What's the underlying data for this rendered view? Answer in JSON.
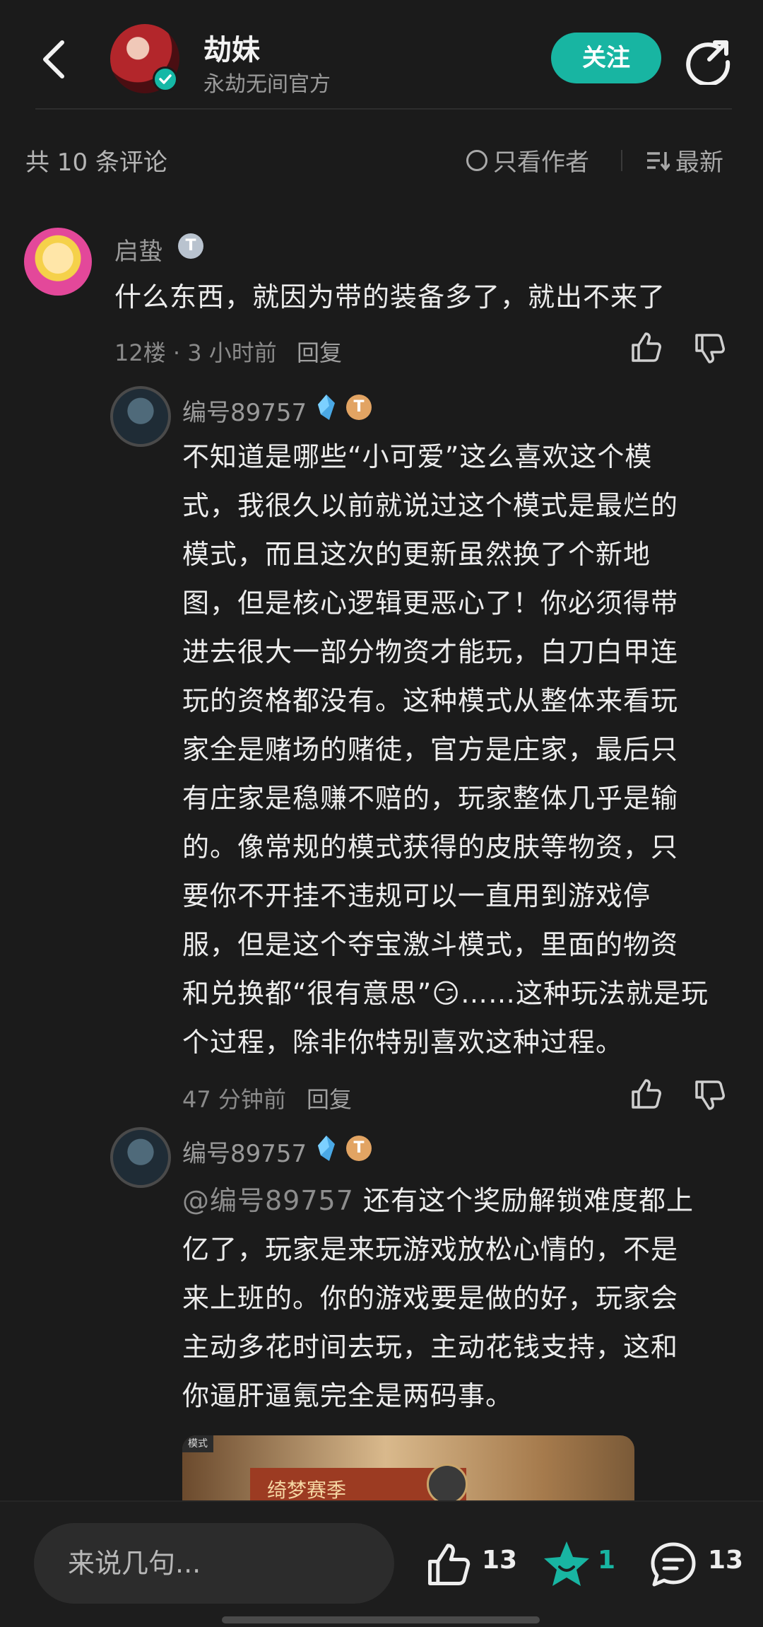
{
  "header": {
    "name": "劫妹",
    "subtitle": "永劫无间官方",
    "follow_label": "关注"
  },
  "filter": {
    "count_label": "共 10 条评论",
    "author_only_label": "只看作者",
    "sort_label": "最新"
  },
  "comments": [
    {
      "user": "启蛰",
      "badge": "T",
      "text": "什么东西，就因为带的装备多了，就出不来了",
      "meta": "12楼 · 3 小时前",
      "reply_label": "回复"
    },
    {
      "user": "编号89757",
      "badge": "T",
      "lines": [
        "不知道是哪些“小可爱”这么喜欢这个模",
        "式，我很久以前就说过这个模式是最烂的",
        "模式，而且这次的更新虽然换了个新地",
        "图，但是核心逻辑更恶心了！你必须得带",
        "进去很大一部分物资才能玩，白刀白甲连",
        "玩的资格都没有。这种模式从整体来看玩",
        "家全是赌场的赌徒，官方是庄家，最后只",
        "有庄家是稳赚不赔的，玩家整体几乎是输",
        "的。像常规的模式获得的皮肤等物资，只",
        "要你不开挂不违规可以一直用到游戏停",
        "服，但是这个夺宝激斗模式，里面的物资",
        "和兑换都“很有意思”😏……这种玩法就是玩",
        "个过程，除非你特别喜欢这种过程。"
      ],
      "meta": "47 分钟前",
      "reply_label": "回复"
    },
    {
      "user": "编号89757",
      "badge": "T",
      "mention": "@编号89757",
      "lines": [
        " 还有这个奖励解锁难度都上",
        "亿了，玩家是来玩游戏放松心情的，不是",
        "来上班的。你的游戏要是做的好，玩家会",
        "主动多花时间去玩，主动花钱支持，这和",
        "你逼肝逼氪完全是两码事。"
      ],
      "image": {
        "tag": "模式",
        "banner": "绮梦赛季"
      }
    }
  ],
  "bottom_bar": {
    "input_placeholder": "来说几句...",
    "like_count": "13",
    "star_count": "1",
    "comment_count": "13"
  },
  "colors": {
    "accent": "#18b5a2",
    "background": "#1b1b1b"
  }
}
